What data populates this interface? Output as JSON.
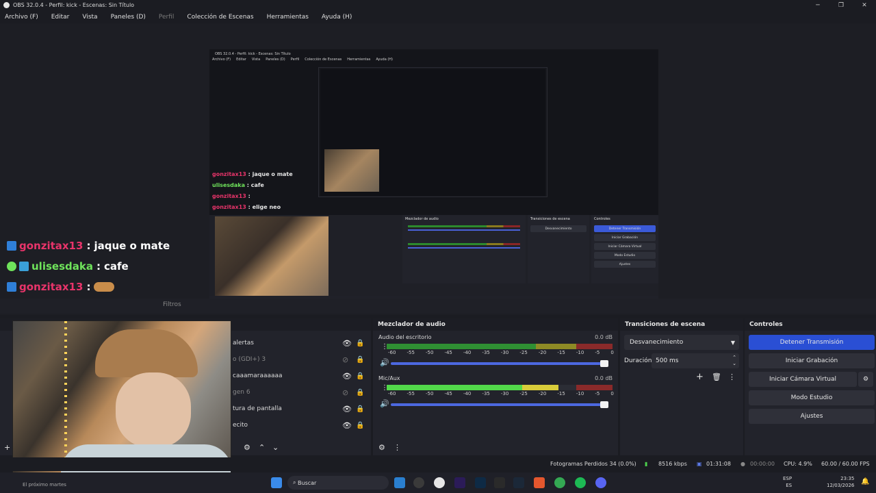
{
  "window": {
    "title": "OBS 32.0.4 - Perfil: kick - Escenas: Sin Título",
    "minimize": "─",
    "maximize": "❐",
    "close": "✕"
  },
  "menu": [
    {
      "label": "Archivo (F)",
      "disabled": false
    },
    {
      "label": "Editar",
      "disabled": false
    },
    {
      "label": "Vista",
      "disabled": false
    },
    {
      "label": "Paneles (D)",
      "disabled": false
    },
    {
      "label": "Perfil",
      "disabled": true
    },
    {
      "label": "Colección de Escenas",
      "disabled": false
    },
    {
      "label": "Herramientas",
      "disabled": false
    },
    {
      "label": "Ayuda (H)",
      "disabled": false
    }
  ],
  "chat": [
    {
      "user": "gonzitax13",
      "sep": ":",
      "msg": "jaque o mate",
      "color": "#e8346a"
    },
    {
      "user": "ulisesdaka",
      "sep": ":",
      "msg": "cafe",
      "color": "#6fe35b"
    },
    {
      "user": "gonzitax13",
      "sep": ":",
      "msg": "",
      "color": "#e8346a"
    },
    {
      "user": "gonzitax13",
      "sep": ":",
      "msg": "elige neo",
      "color": "#e8346a"
    }
  ],
  "preview": {
    "small_mixer_head": "Mezclador de audio",
    "small_trans_head": "Transiciones de escena",
    "small_controls_head": "Controles",
    "small_buttons": [
      "Detener Transmisión",
      "Iniciar Grabación",
      "Iniciar Cámara Virtual",
      "Modo Estudio",
      "Ajustes"
    ]
  },
  "dockbar": {
    "filters": "Filtros"
  },
  "sources": {
    "items": [
      {
        "label": "alertas",
        "visible": true
      },
      {
        "label": "o (GDI+) 3",
        "visible": false
      },
      {
        "label": "caaamaraaaaaa",
        "visible": true
      },
      {
        "label": "gen 6",
        "visible": false
      },
      {
        "label": "tura de pantalla",
        "visible": true
      },
      {
        "label": "ecito",
        "visible": true
      }
    ]
  },
  "mixer": {
    "title": "Mezclador de audio",
    "channels": [
      {
        "name": "Audio del escritorio",
        "db": "0.0 dB",
        "level": 0.66
      },
      {
        "name": "Mic/Aux",
        "db": "0.0 dB",
        "level": 0.76
      }
    ],
    "ticks": [
      "-60",
      "-55",
      "-50",
      "-45",
      "-40",
      "-35",
      "-30",
      "-25",
      "-20",
      "-15",
      "-10",
      "-5",
      "0"
    ]
  },
  "transitions": {
    "title": "Transiciones de escena",
    "selected": "Desvanecimiento",
    "duration_label": "Duración",
    "duration_value": "500 ms"
  },
  "controls": {
    "title": "Controles",
    "stop_stream": "Detener Transmisión",
    "start_recording": "Iniciar Grabación",
    "start_virtual_cam": "Iniciar Cámara Virtual",
    "studio_mode": "Modo Estudio",
    "settings": "Ajustes"
  },
  "status": {
    "dropped_frames": "Fotogramas Perdidos 34 (0.0%)",
    "bitrate": "8516 kbps",
    "stream_time": "01:31:08",
    "rec_time": "00:00:00",
    "cpu": "CPU: 4.9%",
    "fps": "60.00 / 60.00 FPS"
  },
  "taskbar": {
    "search": "Buscar",
    "lang": "ESP",
    "lang2": "ES",
    "time": "23:35",
    "date": "12/03/2026",
    "weather": "El próximo martes"
  },
  "colors": {
    "accent": "#2a4fd4",
    "meter_green": "#2f8f33",
    "meter_yellow": "#8e8a25",
    "meter_red": "#8a2a2a"
  }
}
